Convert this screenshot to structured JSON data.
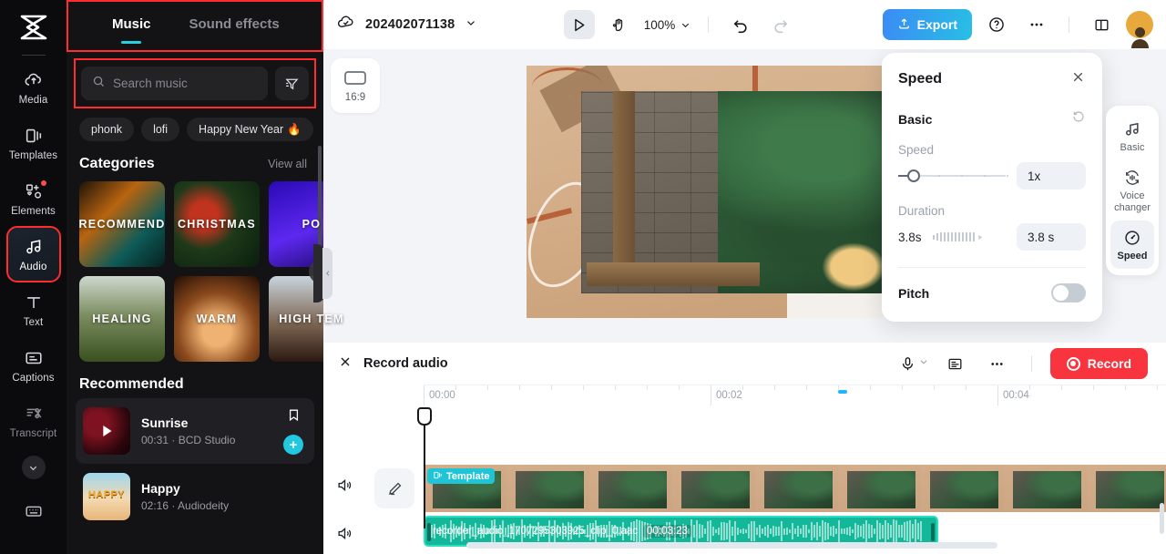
{
  "sidebar": {
    "logo": "capcut-logo",
    "items": [
      {
        "label": "Media",
        "icon": "cloud-upload-icon"
      },
      {
        "label": "Templates",
        "icon": "templates-icon"
      },
      {
        "label": "Elements",
        "icon": "elements-icon",
        "badge": true
      },
      {
        "label": "Audio",
        "icon": "music-note-icon",
        "selected": true
      },
      {
        "label": "Text",
        "icon": "text-icon"
      },
      {
        "label": "Captions",
        "icon": "captions-icon"
      },
      {
        "label": "Transcript",
        "icon": "transcript-icon"
      }
    ],
    "collapse": "chevron-down-icon",
    "keyboard": "keyboard-icon"
  },
  "panel": {
    "tabs": [
      {
        "label": "Music",
        "selected": true
      },
      {
        "label": "Sound effects",
        "selected": false
      }
    ],
    "search": {
      "placeholder": "Search music",
      "value": ""
    },
    "filter_icon": "filter-icon",
    "chips": [
      {
        "label": "phonk"
      },
      {
        "label": "lofi"
      },
      {
        "label": "Happy New Year",
        "emoji": "🔥"
      }
    ],
    "categories_title": "Categories",
    "view_all": "View all",
    "categories": [
      {
        "label": "RECOMMEND"
      },
      {
        "label": "CHRISTMAS"
      },
      {
        "label": "PO"
      },
      {
        "label": "HEALING"
      },
      {
        "label": "WARM"
      },
      {
        "label": "HIGH TEM"
      }
    ],
    "recommended_title": "Recommended",
    "songs": [
      {
        "name": "Sunrise",
        "meta": "00:31 · BCD Studio",
        "highlighted": true
      },
      {
        "name": "Happy",
        "meta": "02:16 · Audiodeity",
        "highlighted": false
      }
    ]
  },
  "topbar": {
    "cloud_icon": "cloud-check-icon",
    "project_name": "202402071138",
    "project_chevron": "chevron-down-icon",
    "select_tool": "cursor-arrow-icon",
    "hand_tool": "hand-icon",
    "zoom_level": "100%",
    "undo": "undo-icon",
    "redo": "redo-icon",
    "export_label": "Export",
    "export_icon": "upload-icon",
    "help": "question-mark-icon",
    "more": "ellipsis-icon",
    "layout": "split-layout-icon",
    "avatar": "user-avatar"
  },
  "stage": {
    "ratio_label": "16:9",
    "ratio_icon": "aspect-ratio-icon"
  },
  "speed_panel": {
    "title": "Speed",
    "close_icon": "close-icon",
    "section": "Basic",
    "reset_icon": "reset-icon",
    "speed_label": "Speed",
    "speed_value": "1x",
    "duration_label": "Duration",
    "duration_left": "3.8s",
    "duration_value": "3.8 s",
    "pitch_label": "Pitch",
    "pitch_on": false
  },
  "tool_rail": [
    {
      "label": "Basic",
      "icon": "music-note-icon",
      "selected": false
    },
    {
      "label": "Voice changer",
      "icon": "voice-changer-icon",
      "selected": false
    },
    {
      "label": "Speed",
      "icon": "speedometer-icon",
      "selected": true
    }
  ],
  "timeline": {
    "close_icon": "close-icon",
    "title": "Record audio",
    "mic_icon": "microphone-icon",
    "mic_chevron": "chevron-down-icon",
    "script_icon": "script-icon",
    "more_icon": "ellipsis-icon",
    "record_label": "Record",
    "ruler_labels": [
      "00:00",
      "00:02",
      "00:04"
    ],
    "video_track": {
      "badge": "Template",
      "badge_icon": "template-icon",
      "mute_icon": "speaker-icon",
      "edit_icon": "pencil-icon"
    },
    "audio_track": {
      "mute_icon": "speaker-icon",
      "clip_name": "recorder_audio_1707295303925_clip_0.aac",
      "clip_duration": "00:03:23"
    }
  },
  "colors": {
    "accent_cyan": "#25d3e0",
    "highlight_red": "#ff2d2d",
    "export_blue": "#3b8bf5",
    "record_red": "#f8353e",
    "audio_clip": "#13b89b"
  }
}
